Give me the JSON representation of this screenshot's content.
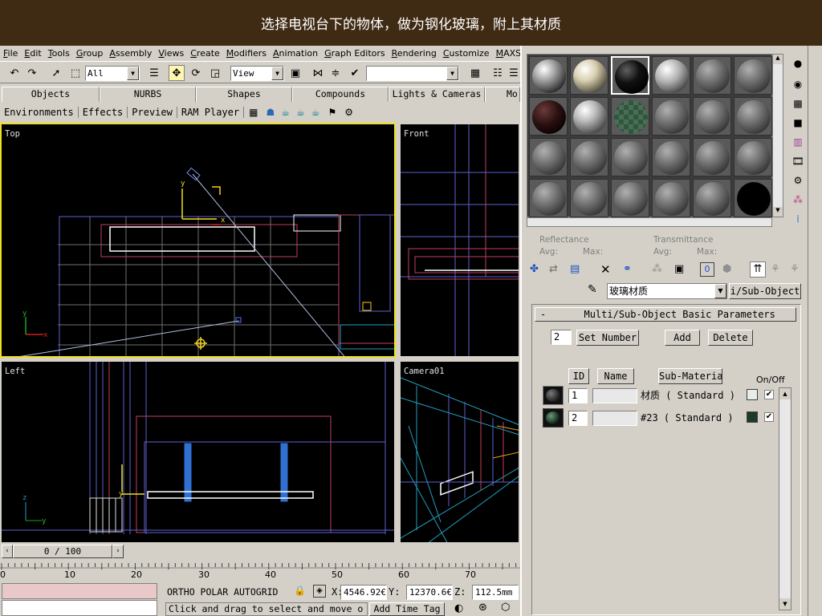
{
  "caption": "选择电视台下的物体，做为钢化玻璃，附上其材质",
  "menu": [
    "File",
    "Edit",
    "Tools",
    "Group",
    "Assembly",
    "Views",
    "Create",
    "Modifiers",
    "Animation",
    "Graph Editors",
    "Rendering",
    "Customize",
    "MAXScript"
  ],
  "toolbar": {
    "selection_filter": "All",
    "ref_coord": "View"
  },
  "tabs": {
    "objects": "Objects",
    "nurbs": "NURBS",
    "shapes": "Shapes",
    "compounds": "Compounds",
    "lights_cameras": "Lights & Cameras",
    "more": "Mo"
  },
  "tab_tools": {
    "environments": "Environments",
    "effects": "Effects",
    "preview": "Preview",
    "ram_player": "RAM Player"
  },
  "viewports": {
    "top": "Top",
    "front": "Front",
    "left": "Left",
    "camera": "Camera01"
  },
  "timeslider": {
    "value": "0 / 100",
    "ticks": [
      "0",
      "10",
      "20",
      "30",
      "40",
      "50",
      "60",
      "70"
    ]
  },
  "status": {
    "snaps": "ORTHO  POLAR  AUTOGRID",
    "x_label": "X:",
    "x_value": "4546.92€",
    "y_label": "Y:",
    "y_value": "12370.6€",
    "z_label": "Z:",
    "z_value": "112.5mm",
    "prompt": "Click and drag to select and move o",
    "add_time_tag": "Add Time Tag"
  },
  "material": {
    "reflectance": "Reflectance",
    "transmittance": "Transmittance",
    "avg": "Avg:",
    "max": "Max:",
    "name": "玻璃材质",
    "type_button": "i/Sub-Object",
    "rollout_sign": "-",
    "rollout_title": "Multi/Sub-Object Basic Parameters",
    "number": "2",
    "set_number": "Set Number",
    "add": "Add",
    "delete": "Delete",
    "col_id": "ID",
    "col_name": "Name",
    "col_submaterial": "Sub-Material",
    "col_onoff": "On/Off",
    "rows": [
      {
        "id": "1",
        "name": "",
        "sub": "材质   ( Standard )",
        "color": "#e8ece8",
        "on": "✔"
      },
      {
        "id": "2",
        "name": "",
        "sub": "#23   ( Standard )",
        "color": "#1e3a26",
        "on": "✔"
      }
    ]
  }
}
